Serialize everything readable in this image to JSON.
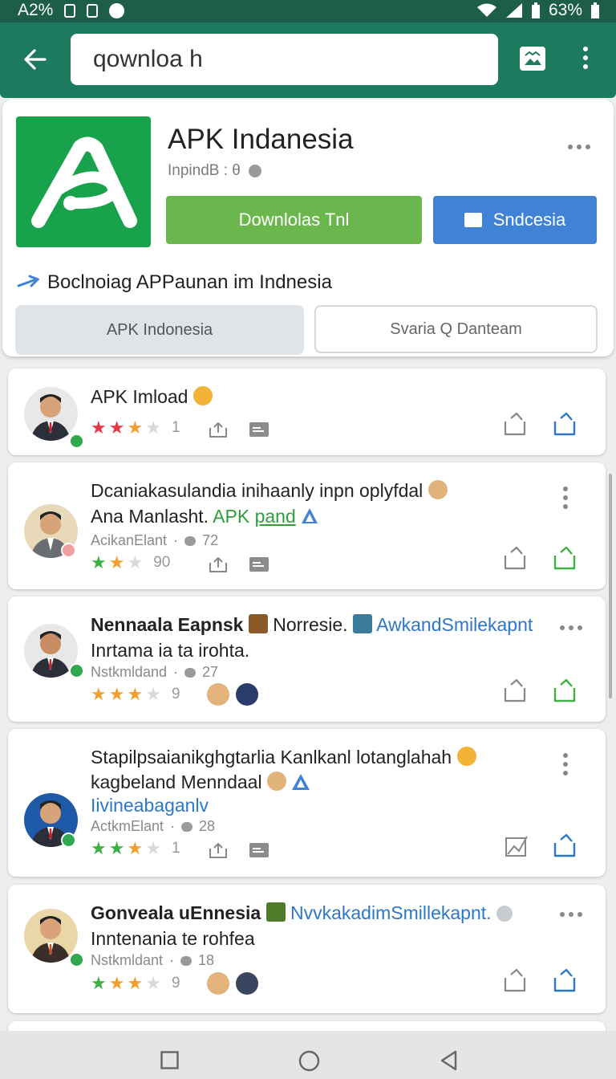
{
  "status": {
    "left_text": "A2%",
    "battery": "63%"
  },
  "search": {
    "value": "qownloa h"
  },
  "app": {
    "title": "APK Indanesia",
    "subtitle": "InpindB : θ",
    "download_label": "Downlolas Tnl",
    "share_label": "Sndcesia",
    "tagline": "Boclnoiag APPaunan im Indnesia",
    "tab1": "APK Indonesia",
    "tab2": "Svaria Q Danteam"
  },
  "reviews": [
    {
      "title": "APK Imload",
      "stars_count": "1",
      "rating": 3
    },
    {
      "line1": "Dcaniakasulandia inihaanly inpn oplyfdal",
      "line2a": "Ana Manlasht. ",
      "line2b": "APK ",
      "line2c": "pand",
      "meta_name": "AcikanElant",
      "meta_count": "72",
      "stars_count": "90",
      "rating": 2
    },
    {
      "bold": "Nennaala Eapnsk",
      "mid": " Norresie. ",
      "link": "AwkandSmilekapnt",
      "line2": "Inrtama ia ta irohta.",
      "meta_name": "Nstkmldand",
      "meta_count": "27",
      "stars_count": "9",
      "rating": 3
    },
    {
      "line1": "Stapilpsaianikghgtarlia Kanlkanl lotanglahah",
      "line2": "kagbeland Menndaal",
      "line3": "Iivineabaganlv",
      "meta_name": "ActkmElant",
      "meta_count": "28",
      "stars_count": "1",
      "rating": 3
    },
    {
      "bold": "Gonveala uEnnesia",
      "link": "NvvkakadimSmillekapnt.",
      "line2": "Inntenania te rohfea",
      "meta_name": "Nstkmldant",
      "meta_count": "18",
      "stars_count": "9",
      "rating": 3
    }
  ],
  "colors": {
    "appbar": "#1d7a5e",
    "download": "#6cb64e",
    "share": "#3f82d6",
    "logo": "#18a24b",
    "star_red": "#e8374a",
    "star_orange": "#f0a030",
    "star_green": "#3cb043"
  }
}
